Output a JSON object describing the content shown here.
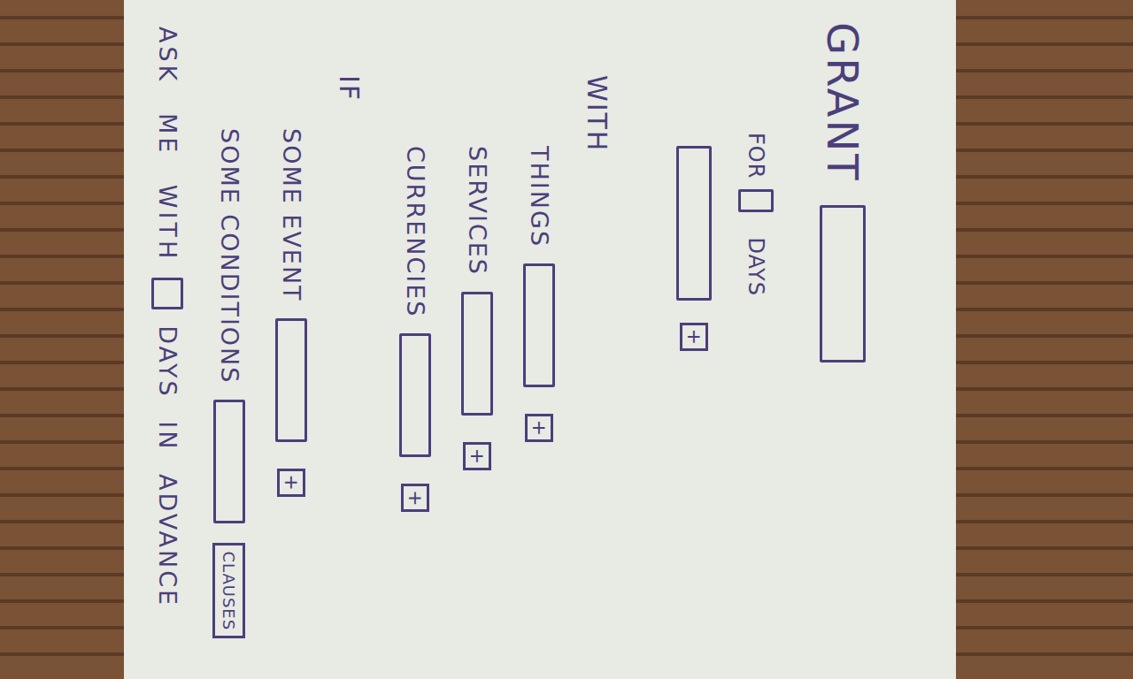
{
  "paper": {
    "title": "GRANT",
    "duration": {
      "prefix": "FOR",
      "suffix": "DAYS"
    },
    "grantee_add": "+",
    "sections": [
      {
        "heading": "WITH",
        "rows": [
          {
            "label": "THINGS",
            "kind": "add",
            "action": "+"
          },
          {
            "label": "SERVICES",
            "kind": "add",
            "action": "+"
          },
          {
            "label": "CURRENCIES",
            "kind": "add",
            "action": "+"
          }
        ]
      },
      {
        "heading": "IF",
        "rows": [
          {
            "label": "SOME EVENT",
            "kind": "add",
            "action": "+"
          },
          {
            "label": "SOME CONDITIONS",
            "kind": "button",
            "action": "CLAUSES"
          }
        ]
      }
    ],
    "notice": {
      "before": "ASK ME WITH",
      "after": "DAYS IN ADVANCE"
    }
  }
}
